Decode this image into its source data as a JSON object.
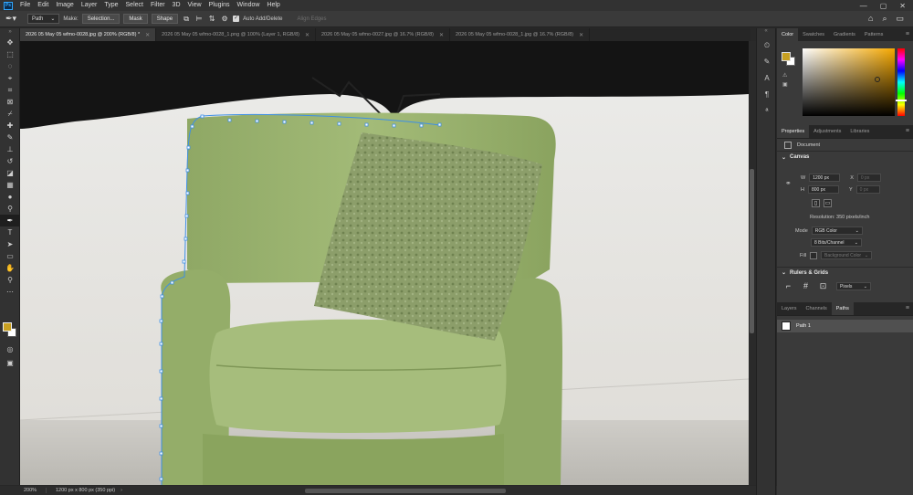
{
  "app": {
    "logo": "Ps"
  },
  "menu": [
    "File",
    "Edit",
    "Image",
    "Layer",
    "Type",
    "Select",
    "Filter",
    "3D",
    "View",
    "Plugins",
    "Window",
    "Help"
  ],
  "window_controls": [
    "—",
    "▢",
    "✕"
  ],
  "options_bar": {
    "mode_value": "Path",
    "make_label": "Make:",
    "selection_label": "Selection...",
    "mask_label": "Mask",
    "shape_label": "Shape",
    "auto_add_delete_label": "Auto Add/Delete",
    "align_edges_label": "Align Edges"
  },
  "tabs": [
    {
      "label": "2026 05 May 05 wfmo-0028.jpg @ 200% (RGB/8) *",
      "active": true
    },
    {
      "label": "2026 05 May 05 wfmo-0028_1.png @ 100% (Layer 1, RGB/8)",
      "active": false
    },
    {
      "label": "2026 05 May 05 wfmo-0027.jpg @ 16.7% (RGB/8)",
      "active": false
    },
    {
      "label": "2026 05 May 05 wfmo-0028_1.jpg @ 16.7% (RGB/8)",
      "active": false
    }
  ],
  "status": {
    "zoom": "200%",
    "info": "1200 px x 800 px (350 ppi)"
  },
  "colors": {
    "foreground": "#c8a021",
    "background": "#ffffff",
    "path_blue": "#3d8fe6"
  },
  "color_panel": {
    "tabs": [
      "Color",
      "Swatches",
      "Gradients",
      "Patterns"
    ]
  },
  "properties_panel": {
    "tabs": [
      "Properties",
      "Adjustments",
      "Libraries"
    ],
    "document_label": "Document",
    "canvas_section": "Canvas",
    "w_label": "W",
    "w_value": "1200 px",
    "h_label": "H",
    "h_value": "800 px",
    "x_label": "X",
    "x_value": "0 px",
    "y_label": "Y",
    "y_value": "0 px",
    "resolution": "Resolution: 350 pixels/inch",
    "mode_label": "Mode",
    "mode_value": "RGB Color",
    "depth_value": "8 Bits/Channel",
    "fill_label": "Fill",
    "fill_value": "Background Color",
    "rulers_section": "Rulers & Grids",
    "units_value": "Pixels"
  },
  "layers_panel": {
    "tabs": [
      "Layers",
      "Channels",
      "Paths"
    ],
    "paths": [
      {
        "name": "Path 1"
      }
    ]
  }
}
